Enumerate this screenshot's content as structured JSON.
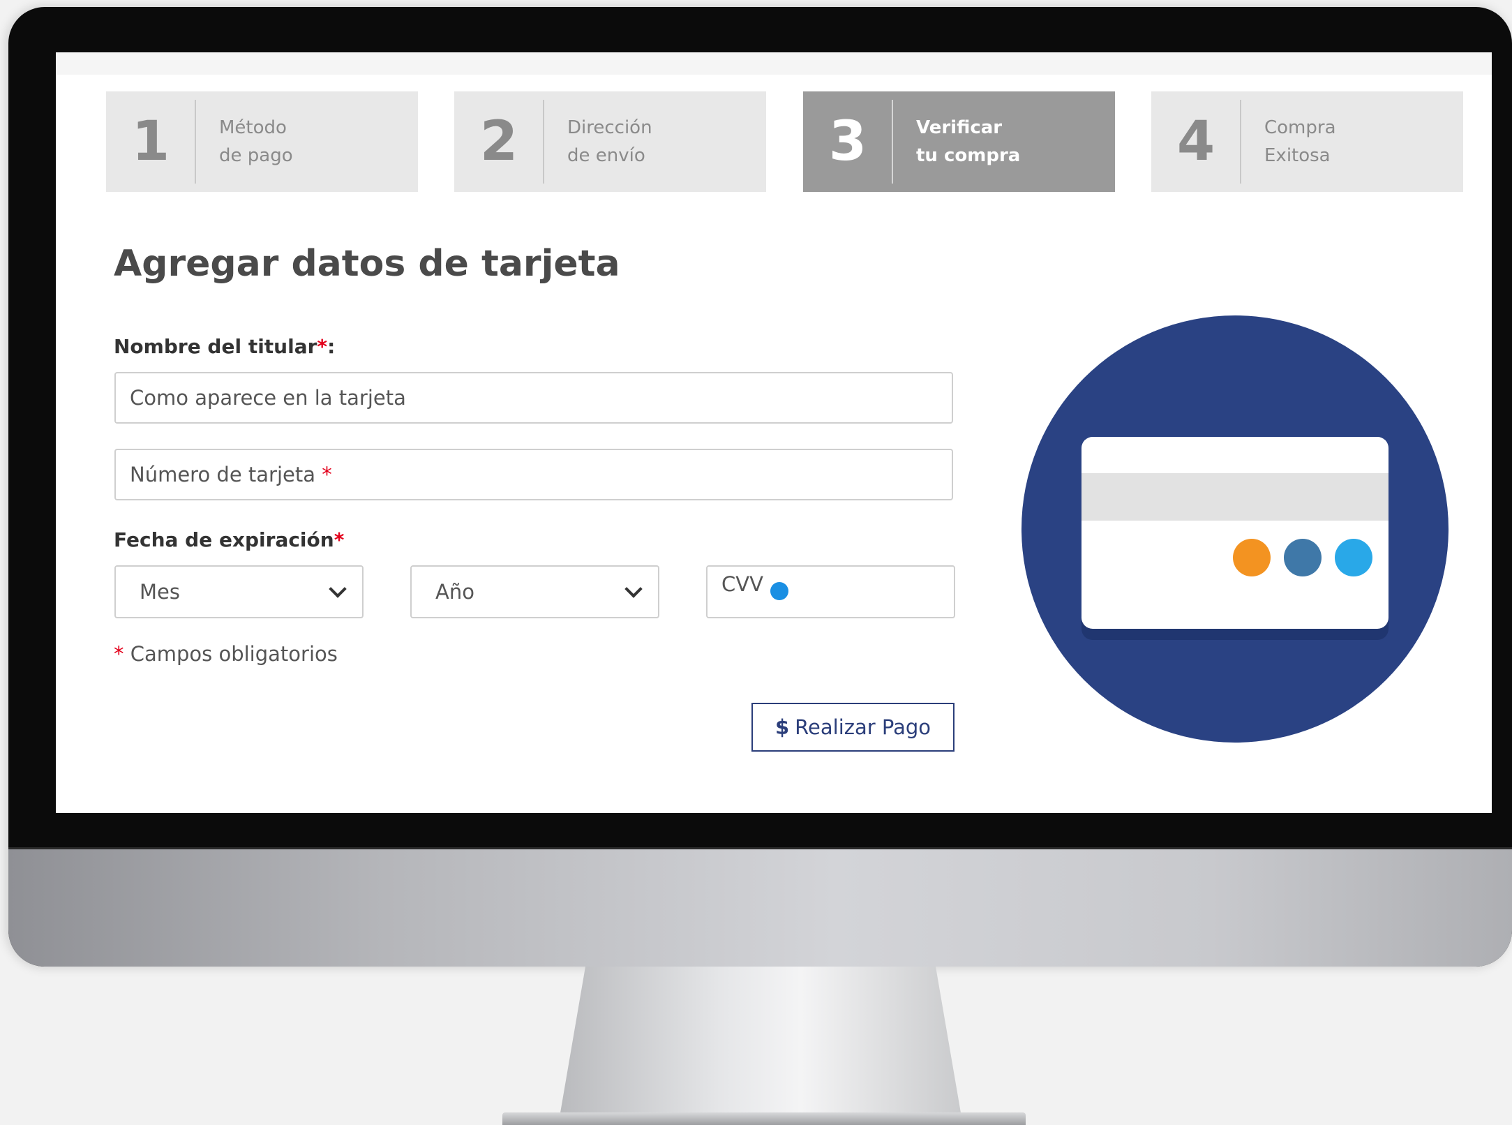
{
  "steps": [
    {
      "number": "1",
      "line1": "Método",
      "line2": "de pago",
      "active": false
    },
    {
      "number": "2",
      "line1": "Dirección",
      "line2": "de envío",
      "active": false
    },
    {
      "number": "3",
      "line1": "Verificar",
      "line2": "tu compra",
      "active": true
    },
    {
      "number": "4",
      "line1": "Compra",
      "line2": "Exitosa",
      "active": false
    }
  ],
  "form": {
    "title": "Agregar datos de tarjeta",
    "holder_label": "Nombre del titular",
    "holder_label_suffix": ":",
    "required_mark": "*",
    "holder_placeholder": "Como aparece en la tarjeta",
    "card_number_placeholder": "Número de tarjeta",
    "expiration_label": "Fecha de expiración",
    "month_value": "Mes",
    "year_value": "Año",
    "cvv_placeholder": "CVV",
    "required_note": "Campos obligatorios",
    "pay_symbol": "$",
    "pay_label": "Realizar Pago"
  },
  "colors": {
    "accent": "#2b3e7a",
    "required": "#e3001b",
    "step_active_bg": "#9a9a9a",
    "step_inactive_bg": "#e8e8e8",
    "illustration_circle": "#2a4283",
    "dot_orange": "#f39321",
    "dot_steel": "#3f78a8",
    "dot_blue": "#29a8e8"
  },
  "icons": {
    "credit_card_illustration": "credit-card-icon",
    "cvv_info": "info-dot-icon",
    "select_chevron": "chevron-down-icon"
  }
}
